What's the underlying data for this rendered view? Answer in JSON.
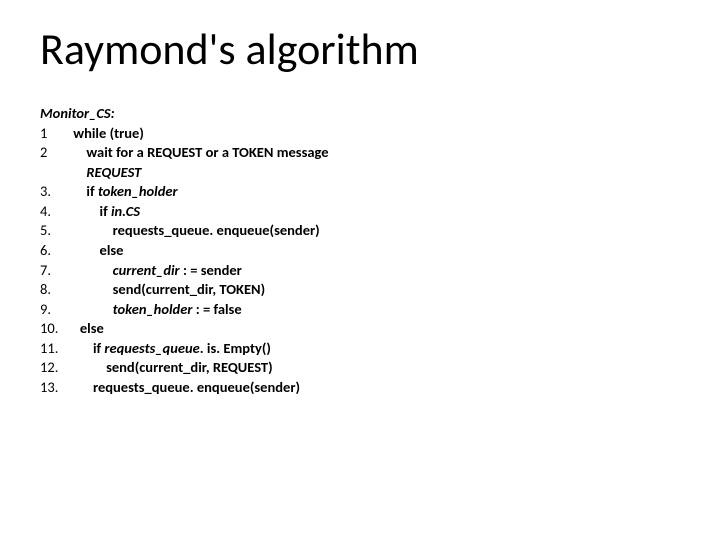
{
  "title": "Raymond's algorithm",
  "proc_name": "Monitor_CS:",
  "lines": {
    "l1_num": "1",
    "l1_txt": "while (true)",
    "l2_num": "2",
    "l2_txt": "wait for a REQUEST or a TOKEN message",
    "l2b_txt": "REQUEST",
    "l3_num": "3.",
    "l3_if": "if ",
    "l3_var": "token_holder",
    "l4_num": "4.",
    "l4_if": "if ",
    "l4_var": "in.CS",
    "l5_num": "5.",
    "l5_txt": "requests_queue. enqueue(sender)",
    "l6_num": "6.",
    "l6_txt": "else",
    "l7_num": "7.",
    "l7_var": "current_dir",
    "l7_txt": " : = sender",
    "l8_num": "8.",
    "l8_txt": "send(current_dir, TOKEN)",
    "l9_num": "9.",
    "l9_var": "token_holder",
    "l9_txt": " : = false",
    "l10_num": "10.",
    "l10_txt": "else",
    "l11_num": "11.",
    "l11_if": "if ",
    "l11_var": "requests_queue",
    "l11_txt": ". is. Empty()",
    "l12_num": "12.",
    "l12_txt": "send(current_dir, REQUEST)",
    "l13_num": "13.",
    "l13_txt": "requests_queue. enqueue(sender)"
  }
}
